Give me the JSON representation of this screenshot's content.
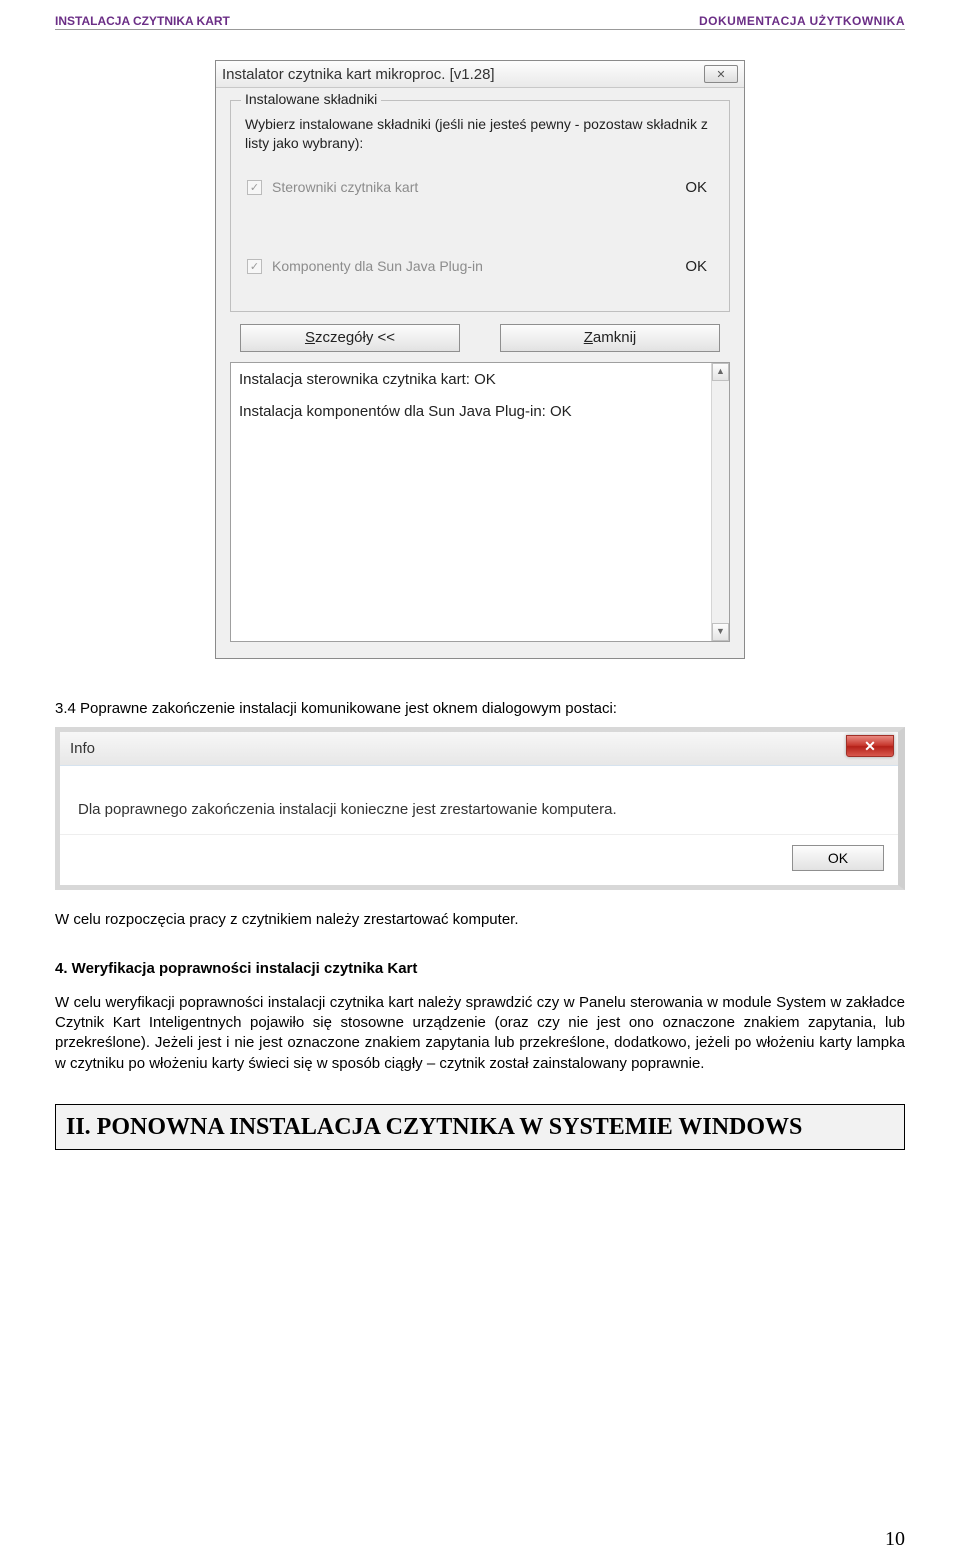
{
  "header": {
    "left": "INSTALACJA CZYTNIKA KART",
    "right": "DOKUMENTACJA  UŻYTKOWNIKA"
  },
  "dialog1": {
    "title": "Instalator czytnika kart mikroproc. [v1.28]",
    "close": "✕",
    "group_legend": "Instalowane składniki",
    "instruction": "Wybierz instalowane składniki (jeśli nie jesteś pewny - pozostaw składnik z listy jako wybrany):",
    "components": [
      {
        "label": "Sterowniki czytnika kart",
        "status": "OK"
      },
      {
        "label": "Komponenty dla Sun Java Plug-in",
        "status": "OK"
      }
    ],
    "btn_details_pre": "S",
    "btn_details_rest": "zczegóły <<",
    "btn_close_pre": "Z",
    "btn_close_rest": "amknij",
    "log_line1": "Instalacja sterownika czytnika kart: OK",
    "log_line2": "Instalacja komponentów dla Sun Java Plug-in: OK"
  },
  "para34": "3.4  Poprawne zakończenie instalacji komunikowane jest oknem dialogowym postaci:",
  "info_dialog": {
    "title": "Info",
    "close": "✕",
    "message": "Dla poprawnego zakończenia instalacji konieczne jest zrestartowanie komputera.",
    "ok": "OK"
  },
  "restart_line": "W celu rozpoczęcia pracy z czytnikiem należy zrestartować komputer.",
  "section4": {
    "title": "4. Weryfikacja poprawności instalacji czytnika Kart",
    "paragraph": "W celu weryfikacji poprawności instalacji czytnika kart należy sprawdzić czy w Panelu sterowania w module System w zakładce Czytnik Kart Inteligentnych pojawiło się stosowne urządzenie (oraz czy nie jest ono oznaczone znakiem zapytania, lub przekreślone). Jeżeli jest i nie jest oznaczone znakiem zapytania lub przekreślone, dodatkowo, jeżeli po włożeniu karty lampka w czytniku po włożeniu karty świeci się w sposób ciągły – czytnik został zainstalowany poprawnie."
  },
  "section2_title": "II. PONOWNA INSTALACJA CZYTNIKA W SYSTEMIE WINDOWS",
  "page_number": "10"
}
